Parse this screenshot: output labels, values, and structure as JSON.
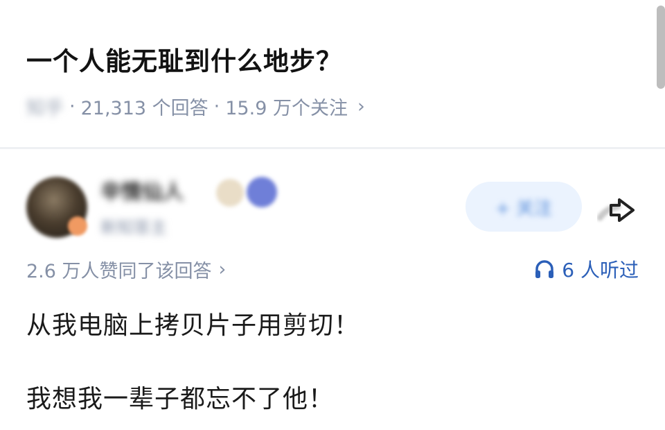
{
  "question": {
    "title": "一个人能无耻到什么地步？",
    "source": "知乎",
    "separator": "·",
    "answers_count": "21,313 个回答",
    "followers": "15.9 万个关注",
    "chevron": "›"
  },
  "author": {
    "name": "辛情仙人",
    "description": "新知答主"
  },
  "follow_button": {
    "label": "+ 关注"
  },
  "answer": {
    "agree_text": "2.6 万人赞同了该回答",
    "agree_chevron": "›",
    "listen_text": "6 人听过",
    "paragraphs": [
      "从我电脑上拷贝片子用剪切！",
      "我想我一辈子都忘不了他！"
    ]
  },
  "icons": {
    "chevron": "chevron-right-icon",
    "headphones": "headphones-icon",
    "share": "share-arrow-icon"
  },
  "colors": {
    "meta_gray": "#8590a6",
    "link_blue": "#2b5fb8",
    "follow_bg": "#ebf3fe"
  }
}
